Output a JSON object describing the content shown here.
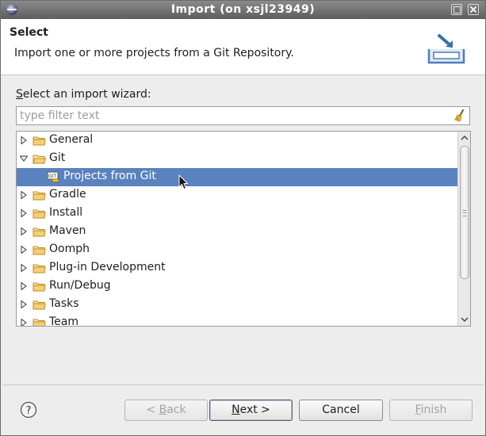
{
  "window": {
    "title": "Import  (on xsjl23949)"
  },
  "header": {
    "title": "Select",
    "description": "Import one or more projects from a Git Repository."
  },
  "wizard": {
    "label_prefix": "S",
    "label_rest": "elect an import wizard:",
    "filter_placeholder": "type filter text"
  },
  "tree": {
    "items": [
      {
        "label": "General",
        "expanded": false,
        "level": 0,
        "icon": "folder-icon"
      },
      {
        "label": "Git",
        "expanded": true,
        "level": 0,
        "icon": "folder-icon"
      },
      {
        "label": "Projects from Git",
        "level": 1,
        "selected": true,
        "icon": "git-project-icon"
      },
      {
        "label": "Gradle",
        "expanded": false,
        "level": 0,
        "icon": "folder-icon"
      },
      {
        "label": "Install",
        "expanded": false,
        "level": 0,
        "icon": "folder-icon"
      },
      {
        "label": "Maven",
        "expanded": false,
        "level": 0,
        "icon": "folder-icon"
      },
      {
        "label": "Oomph",
        "expanded": false,
        "level": 0,
        "icon": "folder-icon"
      },
      {
        "label": "Plug-in Development",
        "expanded": false,
        "level": 0,
        "icon": "folder-icon"
      },
      {
        "label": "Run/Debug",
        "expanded": false,
        "level": 0,
        "icon": "folder-icon"
      },
      {
        "label": "Tasks",
        "expanded": false,
        "level": 0,
        "icon": "folder-icon"
      },
      {
        "label": "Team",
        "expanded": false,
        "level": 0,
        "icon": "folder-icon"
      }
    ]
  },
  "buttons": {
    "back_mnemonic": "B",
    "back_pre": "< ",
    "back_post": "ack",
    "next_mnemonic": "N",
    "next_post": "ext >",
    "cancel": "Cancel",
    "finish_mnemonic": "F",
    "finish_post": "inish"
  },
  "colors": {
    "selection": "#5a82bf",
    "titlebar": "#6f6f6f",
    "folder": "#e8b34a"
  }
}
